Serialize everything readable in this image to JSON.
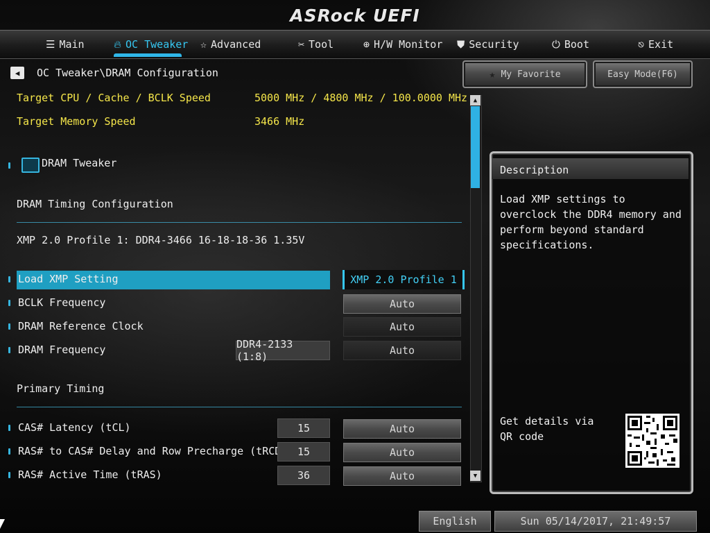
{
  "header": {
    "logo": "ASRock UEFI"
  },
  "nav": {
    "tabs": [
      {
        "label": "Main",
        "icon": "list-icon"
      },
      {
        "label": "OC Tweaker",
        "icon": "flame-icon",
        "active": true
      },
      {
        "label": "Advanced",
        "icon": "star-icon"
      },
      {
        "label": "Tool",
        "icon": "tools-icon"
      },
      {
        "label": "H/W Monitor",
        "icon": "target-icon"
      },
      {
        "label": "Security",
        "icon": "shield-icon"
      },
      {
        "label": "Boot",
        "icon": "power-icon"
      },
      {
        "label": "Exit",
        "icon": "exit-icon"
      }
    ]
  },
  "breadcrumb": "OC Tweaker\\DRAM Configuration",
  "top_buttons": {
    "favorite": "My Favorite",
    "easy_mode": "Easy Mode(F6)"
  },
  "info": {
    "target_cpu_label": "Target CPU / Cache / BCLK Speed",
    "target_cpu_value": "5000 MHz / 4800 MHz / 100.0000 MHz",
    "target_mem_label": "Target Memory Speed",
    "target_mem_value": "3466 MHz"
  },
  "dram_tweaker": "DRAM Tweaker",
  "sections": {
    "timing_config": "DRAM Timing Configuration",
    "xmp_profile": "XMP 2.0 Profile 1: DDR4-3466 16-18-18-36 1.35V",
    "primary_timing": "Primary Timing"
  },
  "settings": [
    {
      "label": "Load XMP Setting",
      "value": "XMP 2.0 Profile 1",
      "current": "",
      "selected": true
    },
    {
      "label": "BCLK Frequency",
      "value": "Auto",
      "current": ""
    },
    {
      "label": "DRAM Reference Clock",
      "value": "Auto",
      "current": ""
    },
    {
      "label": "DRAM Frequency",
      "value": "Auto",
      "current": "DDR4-2133 (1:8)"
    },
    {
      "label": "CAS# Latency (tCL)",
      "value": "Auto",
      "current": "15"
    },
    {
      "label": "RAS# to CAS# Delay and Row Precharge (tRCDtRP)",
      "value": "Auto",
      "current": "15"
    },
    {
      "label": "RAS# Active Time (tRAS)",
      "value": "Auto",
      "current": "36"
    }
  ],
  "description": {
    "title": "Description",
    "text": "Load XMP settings to overclock the DDR4 memory and perform beyond standard specifications.",
    "qr_text": "Get details via QR code"
  },
  "footer": {
    "language": "English",
    "datetime": "Sun 05/14/2017, 21:49:57"
  },
  "colors": {
    "accent": "#2fb6e8",
    "highlight": "#1f9fc2",
    "yellow": "#f5e64a"
  }
}
